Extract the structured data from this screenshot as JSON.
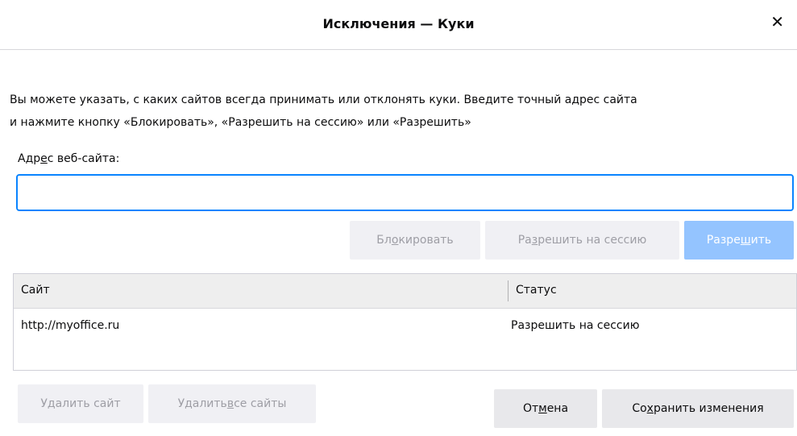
{
  "dialog": {
    "title": "Исключения — Куки",
    "close_glyph": "✕",
    "description_line1": "Вы можете указать, с каких сайтов всегда принимать или отклонять куки. Введите точный адрес сайта",
    "description_line2": "и нажмите кнопку «Блокировать», «Разрешить на сессию» или «Разрешить»",
    "address_label": {
      "pre": "Адр",
      "accel": "е",
      "post": "с веб-сайта:"
    },
    "address_value": ""
  },
  "actions": {
    "block": {
      "pre": "Бл",
      "accel": "о",
      "post": "кировать"
    },
    "allow_session": {
      "pre": "Ра",
      "accel": "з",
      "post": "решить на сессию"
    },
    "allow": {
      "pre": "Разре",
      "accel": "ш",
      "post": "ить"
    }
  },
  "table": {
    "columns": [
      "Сайт",
      "Статус"
    ],
    "rows": [
      {
        "site": "http://myoffice.ru",
        "status": "Разрешить на сессию"
      }
    ]
  },
  "footer": {
    "remove_site": "Удалить сайт",
    "remove_all": {
      "pre": "Удалить ",
      "accel": "в",
      "post": "се сайты"
    },
    "cancel": {
      "pre": "От",
      "accel": "м",
      "post": "ена"
    },
    "save": {
      "pre": "Со",
      "accel": "х",
      "post": "ранить изменения"
    }
  },
  "colors": {
    "focus_ring": "#0a84ff",
    "primary_disabled": "#94c4ff"
  }
}
